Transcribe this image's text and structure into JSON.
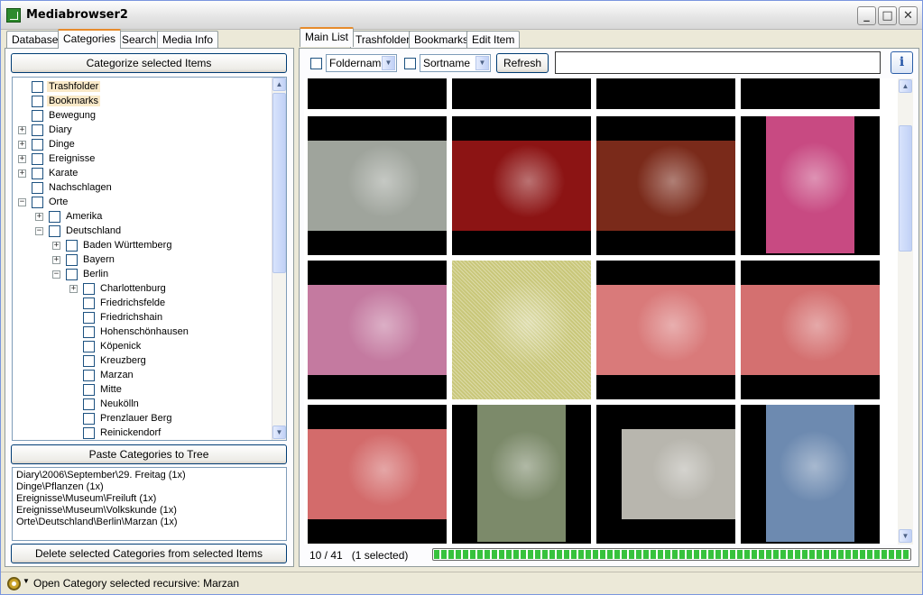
{
  "window": {
    "title": "Mediabrowser2",
    "min": "_",
    "max": "□",
    "close": "✕"
  },
  "left_tabs": [
    "Database",
    "Categories",
    "Search",
    "Media Info"
  ],
  "left": {
    "categorize_btn": "Categorize selected Items",
    "tree": [
      {
        "label": "Trashfolder",
        "level": 0,
        "exp": "",
        "hl": true
      },
      {
        "label": "Bookmarks",
        "level": 0,
        "exp": "",
        "hl": true
      },
      {
        "label": "Bewegung",
        "level": 0,
        "exp": ""
      },
      {
        "label": "Diary",
        "level": 0,
        "exp": "+"
      },
      {
        "label": "Dinge",
        "level": 0,
        "exp": "+"
      },
      {
        "label": "Ereignisse",
        "level": 0,
        "exp": "+"
      },
      {
        "label": "Karate",
        "level": 0,
        "exp": "+"
      },
      {
        "label": "Nachschlagen",
        "level": 0,
        "exp": ""
      },
      {
        "label": "Orte",
        "level": 0,
        "exp": "−"
      },
      {
        "label": "Amerika",
        "level": 1,
        "exp": "+"
      },
      {
        "label": "Deutschland",
        "level": 1,
        "exp": "−"
      },
      {
        "label": "Baden Württemberg",
        "level": 2,
        "exp": "+"
      },
      {
        "label": "Bayern",
        "level": 2,
        "exp": "+"
      },
      {
        "label": "Berlin",
        "level": 2,
        "exp": "−"
      },
      {
        "label": "Charlottenburg",
        "level": 3,
        "exp": "+"
      },
      {
        "label": "Friedrichsfelde",
        "level": 3,
        "exp": ""
      },
      {
        "label": "Friedrichshain",
        "level": 3,
        "exp": ""
      },
      {
        "label": "Hohenschönhausen",
        "level": 3,
        "exp": ""
      },
      {
        "label": "Köpenick",
        "level": 3,
        "exp": ""
      },
      {
        "label": "Kreuzberg",
        "level": 3,
        "exp": ""
      },
      {
        "label": "Marzan",
        "level": 3,
        "exp": ""
      },
      {
        "label": "Mitte",
        "level": 3,
        "exp": ""
      },
      {
        "label": "Neukölln",
        "level": 3,
        "exp": ""
      },
      {
        "label": "Prenzlauer Berg",
        "level": 3,
        "exp": ""
      },
      {
        "label": "Reinickendorf",
        "level": 3,
        "exp": ""
      }
    ],
    "paste_btn": "Paste Categories to Tree",
    "assigned": [
      "Diary\\2006\\September\\29. Freitag (1x)",
      "Dinge\\Pflanzen (1x)",
      "Ereignisse\\Museum\\Freiluft (1x)",
      "Ereignisse\\Museum\\Volkskunde (1x)",
      "Orte\\Deutschland\\Berlin\\Marzan (1x)"
    ],
    "delete_btn": "Delete selected Categories from selected Items"
  },
  "right_tabs": [
    "Main List",
    "Trashfolder",
    "Bookmarks",
    "Edit Item"
  ],
  "toolbar": {
    "folder_combo": "Foldername",
    "sort_combo": "Sortname",
    "refresh_btn": "Refresh",
    "filter_value": "",
    "info_label": "i"
  },
  "thumbnails": [
    {
      "name": "fountain-partial",
      "bg": "#b9bdb7"
    },
    {
      "name": "fountain-partial-2",
      "bg": "#c9c2b1"
    },
    {
      "name": "garden-partial",
      "bg": "#6a7a4a"
    },
    {
      "name": "fountain-partial-3",
      "bg": "#a4a69c"
    },
    {
      "name": "fountain",
      "bg": "#9fa49c"
    },
    {
      "name": "red-dahlias",
      "bg": "#8c1414"
    },
    {
      "name": "red-dahlias-garden",
      "bg": "#7a2a1a"
    },
    {
      "name": "pink-dahlia",
      "bg": "#c84a82"
    },
    {
      "name": "woman-smelling-flower",
      "bg": "#c47aa0"
    },
    {
      "name": "yellow-flowers-selected",
      "bg": "#c9c77a"
    },
    {
      "name": "white-red-dahlia",
      "bg": "#d97a7a"
    },
    {
      "name": "white-red-dahlia-2",
      "bg": "#d47070"
    },
    {
      "name": "white-red-dahlia-3",
      "bg": "#d36b6b"
    },
    {
      "name": "chinese-garden-rocks",
      "bg": "#7c8a6a"
    },
    {
      "name": "white-wall",
      "bg": "#b8b6ae"
    },
    {
      "name": "chinese-pavilion",
      "bg": "#6d8ab0"
    }
  ],
  "status": {
    "count": "10 / 41   (1 selected)",
    "progress": 1.0,
    "message": "Open Category selected recursive: Marzan"
  }
}
